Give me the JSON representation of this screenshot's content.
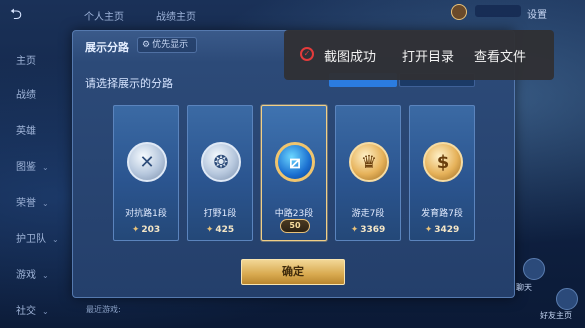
{
  "topbar": {
    "back_icon": "back-arrow-icon",
    "tab1": "个人主页",
    "tab2": "战绩主页",
    "settings": "设置"
  },
  "sidebar": {
    "items": [
      {
        "label": "主页",
        "has_chevron": false
      },
      {
        "label": "战绩",
        "has_chevron": false
      },
      {
        "label": "英雄",
        "has_chevron": false
      },
      {
        "label": "图鉴",
        "has_chevron": true
      },
      {
        "label": "荣誉",
        "has_chevron": true
      },
      {
        "label": "护卫队",
        "has_chevron": true
      },
      {
        "label": "游戏",
        "has_chevron": true
      },
      {
        "label": "社交",
        "has_chevron": true
      }
    ]
  },
  "dialog": {
    "title": "展示分路",
    "priority_button": "优先显示",
    "subtitle": "请选择展示的分路",
    "confirm": "确定",
    "cards": [
      {
        "label": "对抗路1段",
        "score": "203",
        "icon": "sword-badge-icon",
        "tier": "silver",
        "selected": false
      },
      {
        "label": "打野1段",
        "score": "425",
        "icon": "swirl-badge-icon",
        "tier": "silver",
        "selected": false
      },
      {
        "label": "中路23段",
        "score": "",
        "icon": "mid-badge-icon",
        "tier": "blue",
        "selected": true,
        "rank": "50"
      },
      {
        "label": "游走7段",
        "score": "3369",
        "icon": "wing-badge-icon",
        "tier": "gold",
        "selected": false
      },
      {
        "label": "发育路7段",
        "score": "3429",
        "icon": "coin-badge-icon",
        "tier": "gold",
        "selected": false
      }
    ]
  },
  "toast": {
    "message": "截图成功",
    "action_open_dir": "打开目录",
    "action_view_file": "查看文件",
    "icon": "check-circle-icon"
  },
  "bottom": {
    "hint": "最近游戏:",
    "right_label1": "聊天",
    "right_label2": "好友主页"
  }
}
